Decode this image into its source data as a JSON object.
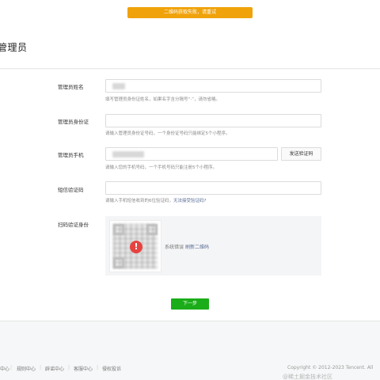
{
  "toast": {
    "text": "二维码获取失败，请重试"
  },
  "header": {
    "title": "管理员"
  },
  "form": {
    "name": {
      "label": "管理员姓名",
      "hint": "填写管理员身份证姓名，如果名字含分隔号“·”，请勿省略。"
    },
    "id_card": {
      "label": "管理员身份证",
      "hint": "请输入管理员身份证号码，一个身份证号码只能绑定5个小程序。"
    },
    "phone": {
      "label": "管理员手机",
      "button": "发送验证码",
      "hint": "请输入您的手机号码，一个手机号码只能注册5个小程序。"
    },
    "sms": {
      "label": "短信验证码",
      "hint_prefix": "请输入手机短信收到的6位验证码，",
      "hint_link": "无法接受验证码?"
    },
    "scan": {
      "label": "扫码验证身份",
      "status_prefix": "系统错误",
      "refresh_link": "刷新二维码",
      "error_glyph": "!"
    }
  },
  "next_button": "下一步",
  "footer": {
    "links": [
      "中心",
      "规则中心",
      "辟谣中心",
      "客服中心",
      "侵权投诉"
    ],
    "separator": "|",
    "copyright": "Copyright © 2012-2023 Tencent. All",
    "watermark": "@稀土掘金技术社区"
  },
  "colors": {
    "primary_green": "#1aad19",
    "toast_orange": "#f0a20a",
    "error_red": "#e64340",
    "link_blue": "#576b95"
  }
}
